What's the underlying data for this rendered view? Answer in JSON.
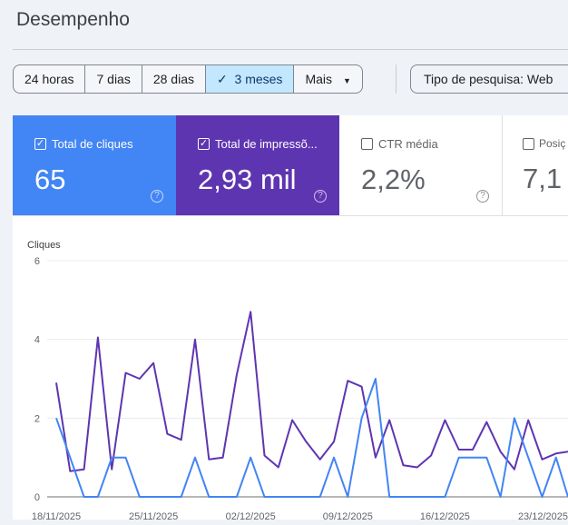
{
  "page_title": "Desempenho",
  "date_range": {
    "options": [
      "24 horas",
      "7 dias",
      "28 dias",
      "3 meses",
      "Mais"
    ],
    "selected": "3 meses"
  },
  "search_type": "Tipo de pesquisa: Web",
  "metrics": [
    {
      "label": "Total de cliques",
      "value": "65",
      "checked": true,
      "color": "#4285f4"
    },
    {
      "label": "Total de impressõ...",
      "value": "2,93 mil",
      "checked": true,
      "color": "#5e35b1"
    },
    {
      "label": "CTR média",
      "value": "2,2%",
      "checked": false
    },
    {
      "label": "Posiç",
      "value": "7,1",
      "checked": false
    }
  ],
  "chart_data": {
    "type": "line",
    "ylabel": "Cliques",
    "ylim": [
      0,
      6
    ],
    "yticks": [
      "0",
      "2",
      "4",
      "6"
    ],
    "xticks": [
      "18/11/2025",
      "25/11/2025",
      "02/12/2025",
      "09/12/2025",
      "16/12/2025",
      "23/12/2025"
    ],
    "grid": true,
    "series": [
      {
        "name": "Total de cliques",
        "color": "#4285f4",
        "values": [
          2,
          1,
          0,
          0,
          1,
          1,
          0,
          0,
          0,
          0,
          1,
          0,
          0,
          0,
          1,
          0,
          0,
          0,
          0,
          0,
          1,
          0,
          2,
          3,
          0,
          0,
          0,
          0,
          0,
          1,
          1,
          1,
          0,
          2,
          1,
          0,
          1,
          0
        ]
      },
      {
        "name": "Total de impressões",
        "color": "#5e35b1",
        "values": [
          2.9,
          0.65,
          0.7,
          4.05,
          0.7,
          3.15,
          3.0,
          3.4,
          1.6,
          1.45,
          4.0,
          0.95,
          1.0,
          3.1,
          4.7,
          1.05,
          0.75,
          1.95,
          1.4,
          0.95,
          1.4,
          2.95,
          2.8,
          1.0,
          1.95,
          0.8,
          0.75,
          1.05,
          1.95,
          1.2,
          1.2,
          1.9,
          1.15,
          0.7,
          1.95,
          0.95,
          1.1,
          1.15
        ]
      }
    ]
  }
}
